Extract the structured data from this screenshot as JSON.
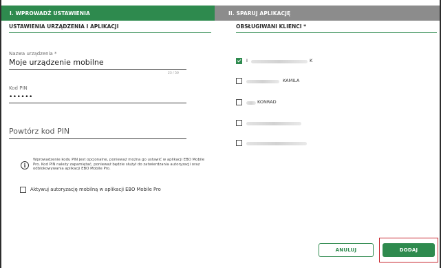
{
  "steps": {
    "step1": "I. WPROWADŹ USTAWIENIA",
    "step2": "II. SPARUJ APLIKACJĘ"
  },
  "left_section": {
    "title": "USTAWIENIA URZĄDZENIA I APLIKACJI",
    "device_name_label": "Nazwa urządzenia *",
    "device_name_value": "Moje urządzenie mobilne",
    "device_name_counter": "23 / 50",
    "pin_label": "Kod PIN",
    "pin_value": "••••••",
    "repeat_pin_placeholder": "Powtórz kod PIN",
    "info_text": "Wprowadzenie kodu PIN jest opcjonalne, ponieważ można go ustawić w aplikacji EBO Mobile Pro. Kod PIN należy zapamiętać, ponieważ będzie służył do zatwierdzania autoryzacji oraz odblokowywania aplikacji EBO Mobile Pro.",
    "mobile_auth_label": "Aktywuj autoryzację mobilną w aplikacji EBO Mobile Pro",
    "mobile_auth_checked": false
  },
  "right_section": {
    "title": "OBSŁUGIWANI KLIENCI *",
    "clients": [
      {
        "visible_prefix": "I",
        "visible_suffix": "K",
        "checked": true
      },
      {
        "visible_prefix": "",
        "visible_suffix": "KAMILA",
        "checked": false
      },
      {
        "visible_prefix": "",
        "visible_suffix": "KONRAD",
        "checked": false
      },
      {
        "visible_prefix": "",
        "visible_suffix": "",
        "checked": false
      },
      {
        "visible_prefix": "",
        "visible_suffix": "",
        "checked": false
      }
    ]
  },
  "buttons": {
    "cancel": "ANULUJ",
    "add": "DODAJ"
  },
  "colors": {
    "accent": "#2e8a4e",
    "inactive_tab": "#8c8c8c",
    "highlight": "#c8232c"
  },
  "icons": {
    "info": "info-circle-icon",
    "check": "checkmark-icon"
  }
}
